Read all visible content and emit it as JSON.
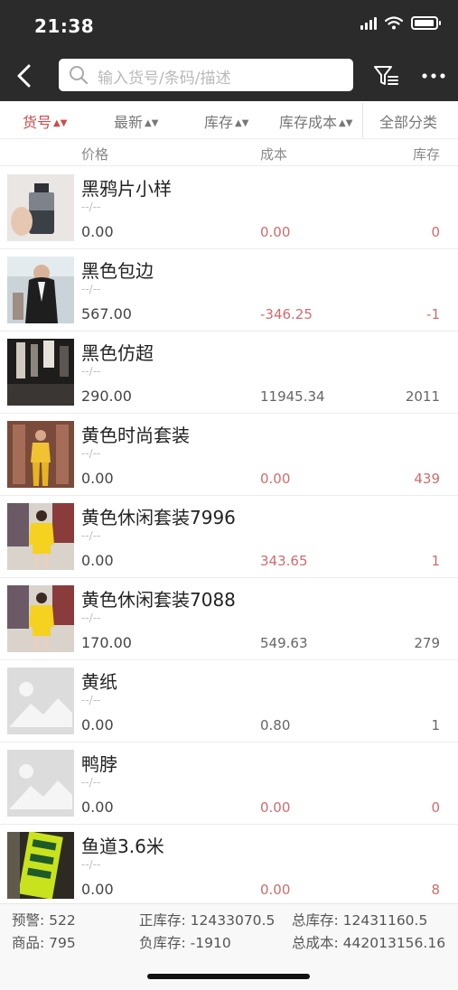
{
  "status": {
    "time": "21:38"
  },
  "search": {
    "placeholder": "输入货号/条码/描述"
  },
  "sort_tabs": [
    {
      "label": "货号",
      "active": true
    },
    {
      "label": "最新",
      "active": false
    },
    {
      "label": "库存",
      "active": false
    },
    {
      "label": "库存成本",
      "active": false
    }
  ],
  "category": {
    "label": "全部分类"
  },
  "columns": {
    "price": "价格",
    "cost": "成本",
    "stock": "库存"
  },
  "products": [
    {
      "name": "黑鸦片小样",
      "spec": "--/--",
      "price": "0.00",
      "cost": "0.00",
      "stock": "0",
      "thumb": "perfume"
    },
    {
      "name": "黑色包边",
      "spec": "--/--",
      "price": "567.00",
      "cost": "-346.25",
      "stock": "-1",
      "thumb": "black-blazer"
    },
    {
      "name": "黑色仿超",
      "spec": "--/--",
      "price": "290.00",
      "cost": "11945.34",
      "stock": "2011",
      "thumb": "dark-room"
    },
    {
      "name": "黄色时尚套装",
      "spec": "--/--",
      "price": "0.00",
      "cost": "0.00",
      "stock": "439",
      "thumb": "yellow-suit"
    },
    {
      "name": "黄色休闲套装7996",
      "spec": "--/--",
      "price": "0.00",
      "cost": "343.65",
      "stock": "1",
      "thumb": "yellow-casual"
    },
    {
      "name": "黄色休闲套装7088",
      "spec": "--/--",
      "price": "170.00",
      "cost": "549.63",
      "stock": "279",
      "thumb": "yellow-casual"
    },
    {
      "name": "黄纸",
      "spec": "--/--",
      "price": "0.00",
      "cost": "0.80",
      "stock": "1",
      "thumb": "placeholder"
    },
    {
      "name": "鸭脖",
      "spec": "--/--",
      "price": "0.00",
      "cost": "0.00",
      "stock": "0",
      "thumb": "placeholder"
    },
    {
      "name": "鱼道3.6米",
      "spec": "--/--",
      "price": "0.00",
      "cost": "0.00",
      "stock": "8",
      "thumb": "green-sign"
    }
  ],
  "footer": {
    "warning": "预警: 522",
    "positive_stock": "正库存: 12433070.5",
    "total_stock": "总库存: 12431160.5",
    "goods": "商品: 795",
    "negative_stock": "负库存: -1910",
    "total_cost": "总成本: 442013156.16"
  },
  "colors": {
    "header": "#2b2b2b",
    "accent": "#cf4a4a",
    "negative": "#d26b6b"
  }
}
